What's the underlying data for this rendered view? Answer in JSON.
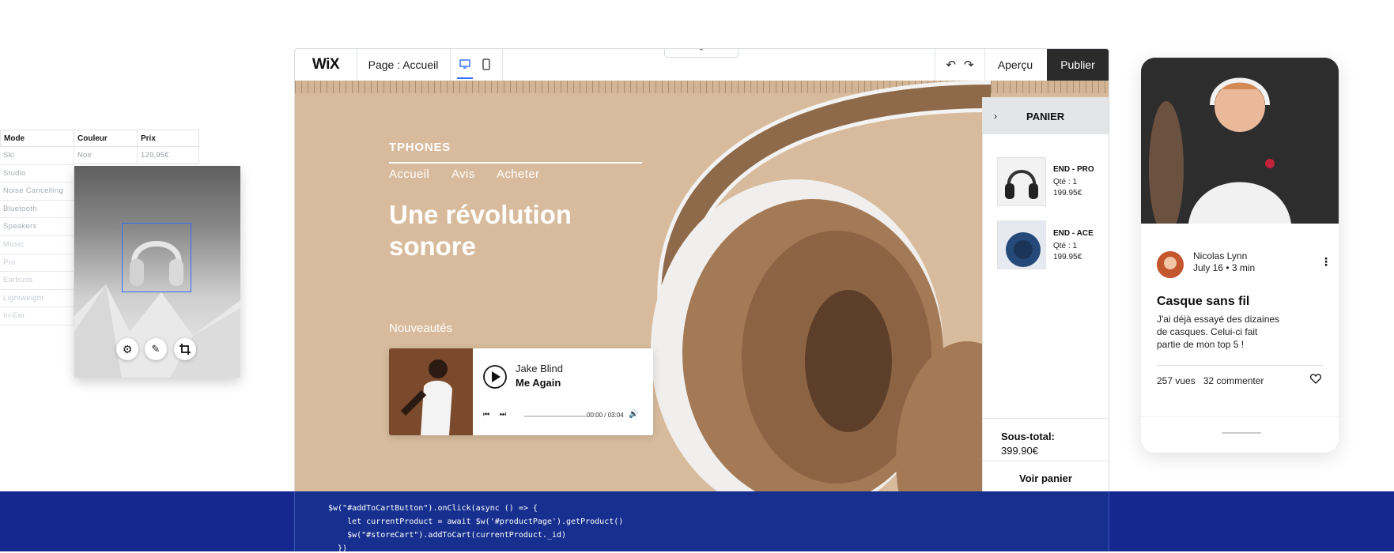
{
  "table": {
    "headers": [
      "Mode",
      "Couleur",
      "Prix"
    ],
    "first_row": [
      "Noir",
      "129,95€"
    ],
    "modes": [
      "Ski",
      "Studio",
      "Noise Cancelling",
      "Bluetooth",
      "Speakers",
      "Music",
      "Pro",
      "Earbuds",
      "Lightweight",
      "In-Ear"
    ]
  },
  "image_tools": [
    "gear-icon",
    "pen-icon",
    "crop-icon"
  ],
  "editor": {
    "logo": "WiX",
    "page_label": "Page : Accueil",
    "view_modes": [
      "desktop-icon",
      "mobile-icon"
    ],
    "preview_label": "Aperçu",
    "publish_label": "Publier",
    "collapse_glyph": "⌃"
  },
  "site": {
    "brand": "TPHONES",
    "nav": [
      "Accueil",
      "Avis",
      "Acheter"
    ],
    "hero": "Une révolution sonore",
    "section_label": "Nouveautés",
    "player": {
      "artist": "Jake Blind",
      "track": "Me Again",
      "time": "00:00 / 03:04"
    }
  },
  "cart": {
    "title": "PANIER",
    "items": [
      {
        "name": "END - PRO",
        "qty": "Qté : 1",
        "price": "199.95€"
      },
      {
        "name": "END - ACE",
        "qty": "Qté : 1",
        "price": "199.95€"
      }
    ],
    "subtotal_label": "Sous-total:",
    "subtotal_value": "399.90€",
    "view_cart": "Voir panier"
  },
  "code": {
    "lines": [
      "$w(\"#addToCartButton\").onClick(async () => {",
      "    let currentProduct = await $w('#productPage').getProduct()",
      "    $w(\"#storeCart\").addToCart(currentProduct._id)",
      "  })"
    ]
  },
  "blog": {
    "author": "Nicolas Lynn",
    "meta": "July 16 •  3 min",
    "title": "Casque sans fil",
    "body": "J'ai déjà essayé des dizaines de casques. Celui-ci fait partie de mon top 5 !",
    "views": "257 vues",
    "comments": "32 commenter"
  },
  "colors": {
    "hero_bg": "#d8bb9c",
    "publish_bg": "#2b2b2b",
    "code_bg": "#15288f",
    "selection": "#2f6df6"
  }
}
